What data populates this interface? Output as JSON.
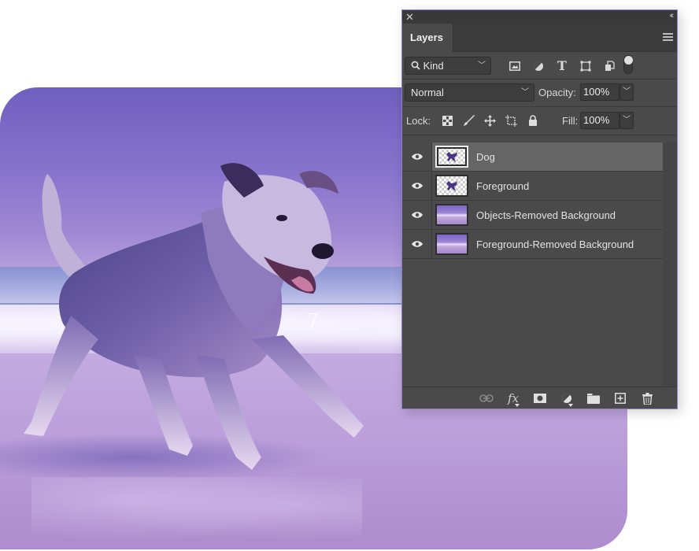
{
  "canvas": {
    "overlay_text": "7",
    "subject": "dog running on beach (purple-tinted photo)"
  },
  "panel": {
    "close_icon": "close-icon",
    "collapse_icon": "double-chevron-icon",
    "tab_label": "Layers",
    "menu_icon": "hamburger-menu-icon",
    "filter": {
      "kind_label": "Kind",
      "icons": [
        "pixel-layer-filter-icon",
        "adjustment-layer-filter-icon",
        "type-layer-filter-icon",
        "shape-layer-filter-icon",
        "smart-object-filter-icon"
      ],
      "toggle_on": true
    },
    "blend_mode": "Normal",
    "opacity_label": "Opacity:",
    "opacity_value": "100%",
    "lock_label": "Lock:",
    "lock_icons": [
      "lock-transparent-pixels-icon",
      "lock-image-pixels-icon",
      "lock-position-icon",
      "lock-artboard-icon",
      "lock-all-icon"
    ],
    "fill_label": "Fill:",
    "fill_value": "100%",
    "layers": [
      {
        "name": "Dog",
        "visible": true,
        "selected": true,
        "thumb": "dog-cutout"
      },
      {
        "name": "Foreground",
        "visible": true,
        "selected": false,
        "thumb": "dog-cutout"
      },
      {
        "name": "Objects-Removed Background",
        "visible": true,
        "selected": false,
        "thumb": "beach-background"
      },
      {
        "name": "Foreground-Removed Background",
        "visible": true,
        "selected": false,
        "thumb": "beach-background"
      }
    ],
    "footer_icons": [
      "link-layers-icon",
      "fx-icon",
      "add-mask-icon",
      "adjustment-layer-icon",
      "new-group-icon",
      "new-layer-icon",
      "trash-icon"
    ]
  }
}
